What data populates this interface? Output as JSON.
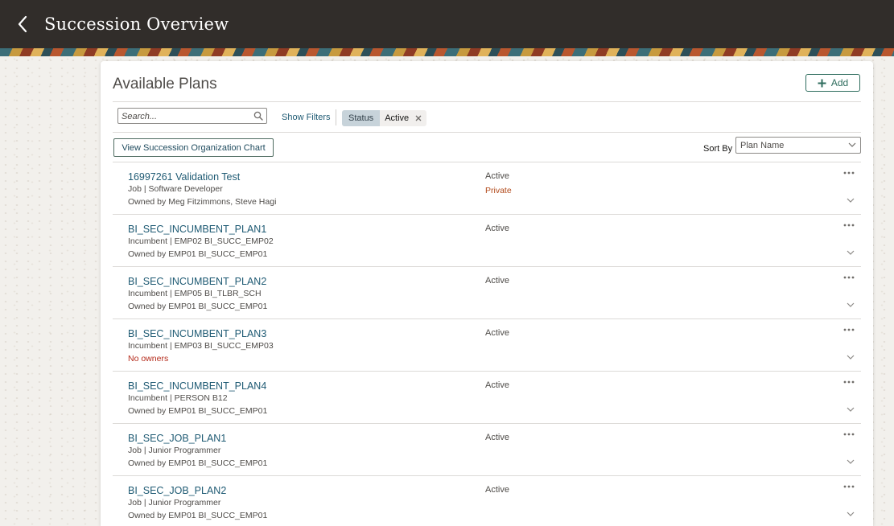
{
  "header": {
    "title": "Succession Overview"
  },
  "card": {
    "title": "Available Plans",
    "add_label": "Add"
  },
  "filters": {
    "search_placeholder": "Search...",
    "show_filters": "Show Filters",
    "chip_key": "Status",
    "chip_value": "Active"
  },
  "toolbar": {
    "org_chart_label": "View Succession Organization Chart",
    "sort_label": "Sort By",
    "sort_value": "Plan Name"
  },
  "plans": [
    {
      "name": "16997261 Validation Test",
      "sub": "Job | Software Developer",
      "owner": "Owned by Meg Fitzimmons, Steve Hagi",
      "status": "Active",
      "private": "Private"
    },
    {
      "name": "BI_SEC_INCUMBENT_PLAN1",
      "sub": "Incumbent | EMP02 BI_SUCC_EMP02",
      "owner": "Owned by EMP01 BI_SUCC_EMP01",
      "status": "Active"
    },
    {
      "name": "BI_SEC_INCUMBENT_PLAN2",
      "sub": "Incumbent | EMP05 BI_TLBR_SCH",
      "owner": "Owned by EMP01 BI_SUCC_EMP01",
      "status": "Active"
    },
    {
      "name": "BI_SEC_INCUMBENT_PLAN3",
      "sub": "Incumbent | EMP03 BI_SUCC_EMP03",
      "owner": "No owners",
      "owner_warn": true,
      "status": "Active"
    },
    {
      "name": "BI_SEC_INCUMBENT_PLAN4",
      "sub": "Incumbent | PERSON B12",
      "owner": "Owned by EMP01 BI_SUCC_EMP01",
      "status": "Active"
    },
    {
      "name": "BI_SEC_JOB_PLAN1",
      "sub": "Job | Junior Programmer",
      "owner": "Owned by EMP01 BI_SUCC_EMP01",
      "status": "Active"
    },
    {
      "name": "BI_SEC_JOB_PLAN2",
      "sub": "Job | Junior Programmer",
      "owner": "Owned by EMP01 BI_SUCC_EMP01",
      "status": "Active"
    }
  ],
  "colors": {
    "header_bg": "#312d2a",
    "link": "#1e5a73",
    "accent": "#2f6d5e",
    "warn": "#b42a1a"
  },
  "icons": [
    "back-chevron-icon",
    "plus-icon",
    "search-icon",
    "close-icon",
    "chevron-down-icon",
    "more-icon"
  ]
}
